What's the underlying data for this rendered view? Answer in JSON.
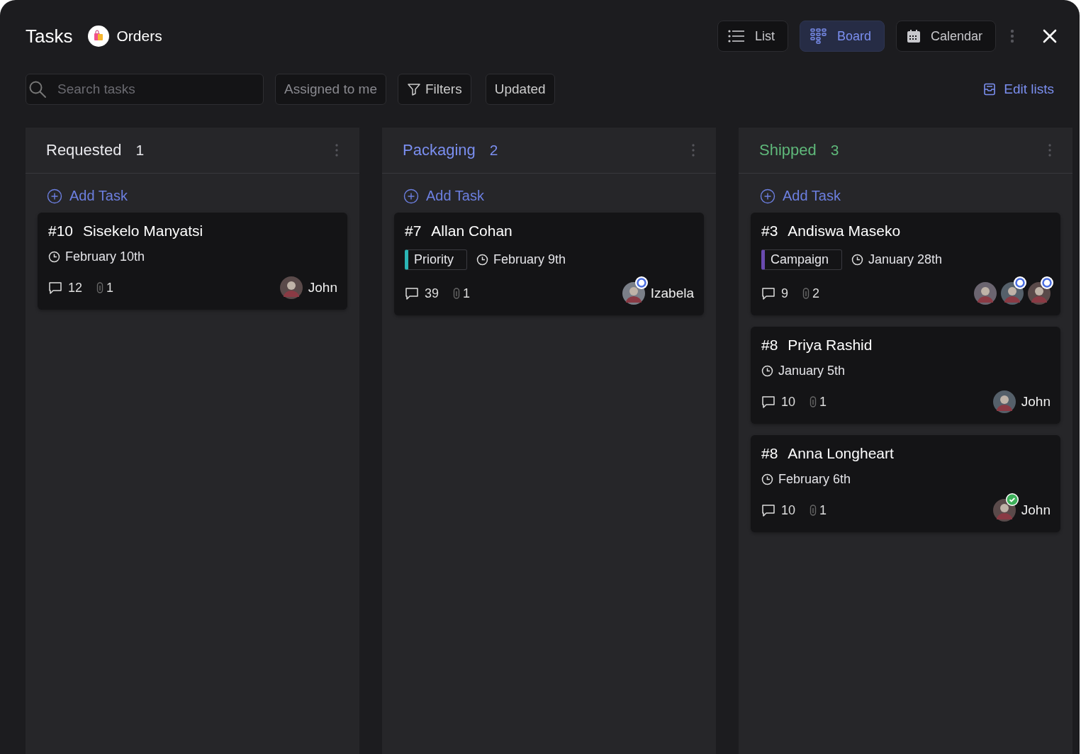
{
  "header": {
    "title": "Tasks",
    "project": "Orders"
  },
  "views": [
    {
      "label": "List",
      "kind": "list",
      "selected": false
    },
    {
      "label": "Board",
      "kind": "board",
      "selected": true
    },
    {
      "label": "Calendar",
      "kind": "calendar",
      "selected": false
    }
  ],
  "toolbar": {
    "search": {
      "placeholder": "Search tasks"
    },
    "filters": [
      {
        "label": "Assigned to me",
        "kind": "toggle"
      },
      {
        "label": "Filters",
        "kind": "filter"
      },
      {
        "label": "Updated",
        "kind": "sort"
      }
    ],
    "edit_lists": "Edit lists"
  },
  "columns": [
    {
      "name": "Requested",
      "count": "1",
      "color": "#e8e8ec",
      "add_label": "Add Task",
      "cards": [
        {
          "number": "#10",
          "title": "Sisekelo Manyatsi",
          "date": "February 10th",
          "comments": "12",
          "attachments": "1",
          "assignees": [
            {
              "name": "John",
              "in_progress": false,
              "done": false
            }
          ]
        }
      ]
    },
    {
      "name": "Packaging",
      "count": "2",
      "color": "#7b8ff0",
      "add_label": "Add Task",
      "cards": [
        {
          "number": "#7",
          "title": "Allan Cohan",
          "tag": {
            "label": "Priority",
            "color": "#2bb5b5"
          },
          "date": "February 9th",
          "comments": "39",
          "attachments": "1",
          "assignees": [
            {
              "name": "Izabela",
              "in_progress": true,
              "done": false
            }
          ]
        }
      ]
    },
    {
      "name": "Shipped",
      "count": "3",
      "color": "#5fb87a",
      "add_label": "Add Task",
      "cards": [
        {
          "number": "#3",
          "title": "Andiswa Maseko",
          "tag": {
            "label": "Campaign",
            "color": "#6a4bb0"
          },
          "date": "January 28th",
          "comments": "9",
          "attachments": "2",
          "assignees": [
            {
              "in_progress": false,
              "done": false
            },
            {
              "in_progress": true,
              "done": false
            },
            {
              "in_progress": true,
              "done": false
            }
          ]
        },
        {
          "number": "#8",
          "title": "Priya Rashid",
          "date": "January 5th",
          "comments": "10",
          "attachments": "1",
          "assignees": [
            {
              "name": "John",
              "in_progress": false,
              "done": false
            }
          ]
        },
        {
          "number": "#8",
          "title": "Anna Longheart",
          "date": "February 6th",
          "comments": "10",
          "attachments": "1",
          "assignees": [
            {
              "name": "John",
              "in_progress": false,
              "done": true
            }
          ]
        }
      ]
    }
  ]
}
